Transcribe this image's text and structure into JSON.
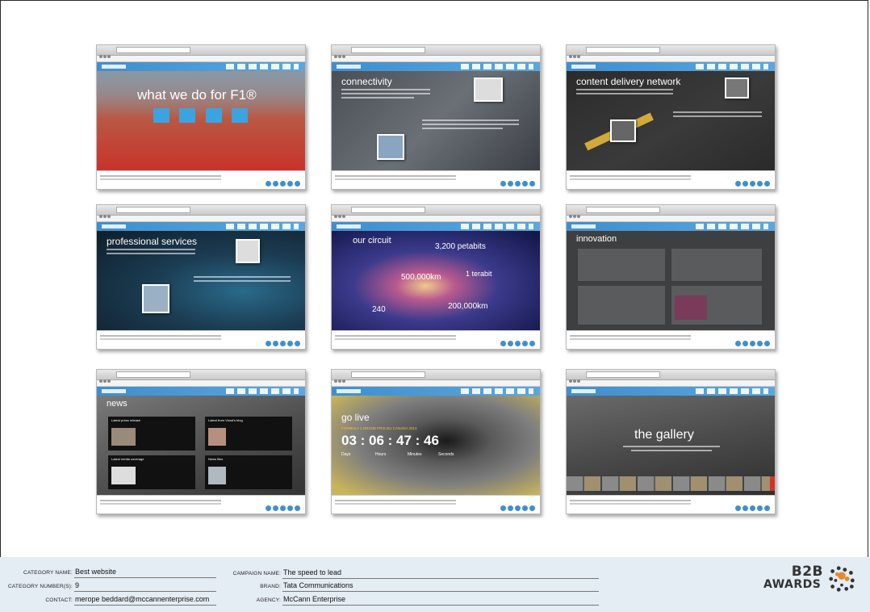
{
  "thumbnails": [
    {
      "id": "what-we-do",
      "title": "what we do for F1®"
    },
    {
      "id": "connectivity",
      "title": "connectivity"
    },
    {
      "id": "content-delivery",
      "title": "content delivery network"
    },
    {
      "id": "professional-services",
      "title": "professional services"
    },
    {
      "id": "our-circuit",
      "title": "our circuit",
      "stats": [
        "3,200 petabits",
        "1 terabit",
        "500,000km",
        "240",
        "200,000km"
      ]
    },
    {
      "id": "innovation",
      "title": "innovation"
    },
    {
      "id": "news",
      "title": "news",
      "boxes": [
        "Latest press release",
        "Latest from Vinod's blog",
        "Latest media coverage",
        "News files"
      ]
    },
    {
      "id": "go-live",
      "title": "go live",
      "subtitle": "FORMULA 1 GRAND PRIX DU CANADA 2013",
      "countdown": "03 : 06 : 47 : 46",
      "units": [
        "Days",
        "Hours",
        "Minutes",
        "Seconds"
      ]
    },
    {
      "id": "gallery",
      "title": "the gallery"
    }
  ],
  "info": {
    "category_name_label": "Category name:",
    "category_name": "Best website",
    "category_number_label": "Category number(s):",
    "category_number": "9",
    "contact_label": "Contact:",
    "contact": "merope beddard@mccannenterprise.com",
    "campaign_name_label": "Campaign name:",
    "campaign_name": "The speed to lead",
    "brand_label": "Brand:",
    "brand": "Tata Communications",
    "agency_label": "Agency:",
    "agency": "McCann Enterprise"
  },
  "logo": {
    "line1": "B2B",
    "line2": "AWARDS"
  },
  "colors": {
    "header_blue": "#3f8fce",
    "info_band": "#e4ecf4"
  }
}
